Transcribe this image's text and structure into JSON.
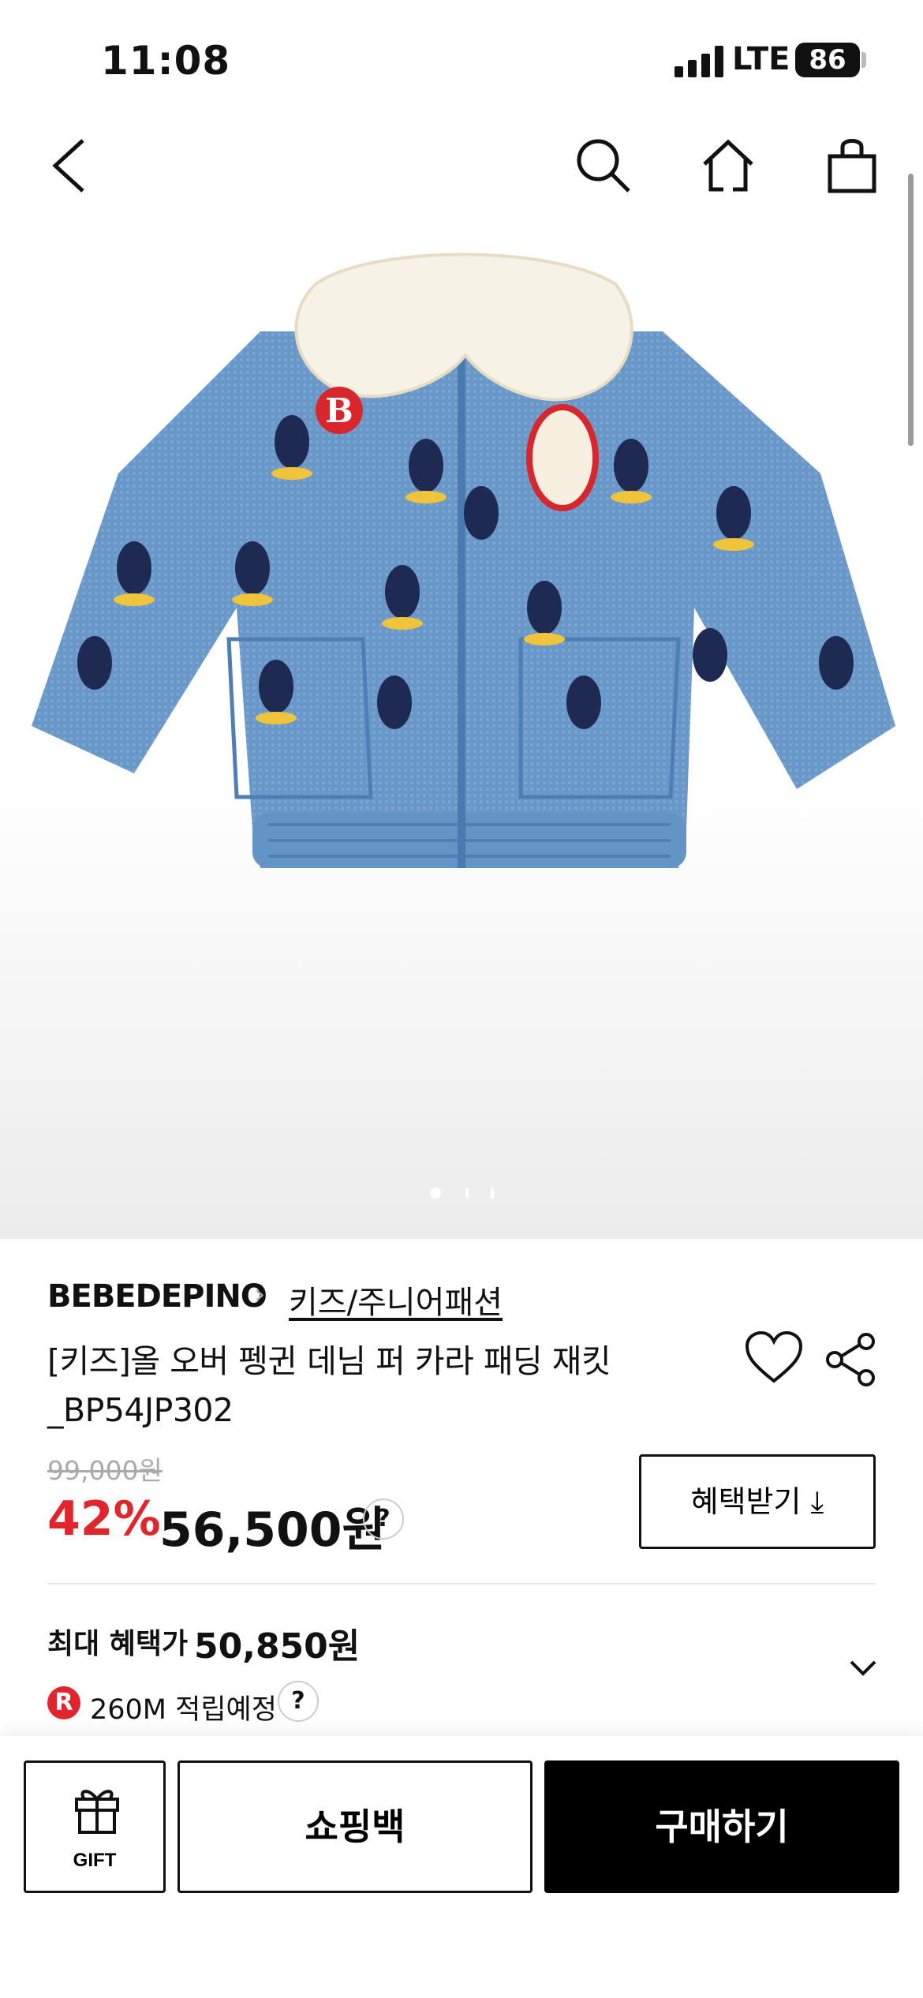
{
  "status_bar": {
    "time": "11:08",
    "network": "LTE",
    "battery": "86"
  },
  "nav": {
    "back_icon": "chevron-left-icon",
    "search_icon": "search-icon",
    "home_icon": "home-icon",
    "bag_icon": "shopping-bag-icon"
  },
  "gallery": {
    "image": "penguin-denim-jacket-photo",
    "page_indicator": {
      "current": 1,
      "total": 3
    }
  },
  "product": {
    "brand": "BEBEDEPINO",
    "category": "키즈/주니어패션",
    "name": "[키즈]올 오버 펭귄 데님 퍼 카라 패딩 재킷 _BP54JP302",
    "original_price": "99,000원",
    "discount": "42%",
    "price": "56,500원",
    "help": "?",
    "benefit_button": "혜택받기 ⤓"
  },
  "benefits": {
    "max_label": "최대 혜택가",
    "max_value": "50,850원",
    "reward_badge": "R",
    "reward_text": "260M 적립예정",
    "help": "?"
  },
  "bottom_bar": {
    "gift_label": "GIFT",
    "cart_label": "쇼핑백",
    "buy_label": "구매하기"
  }
}
